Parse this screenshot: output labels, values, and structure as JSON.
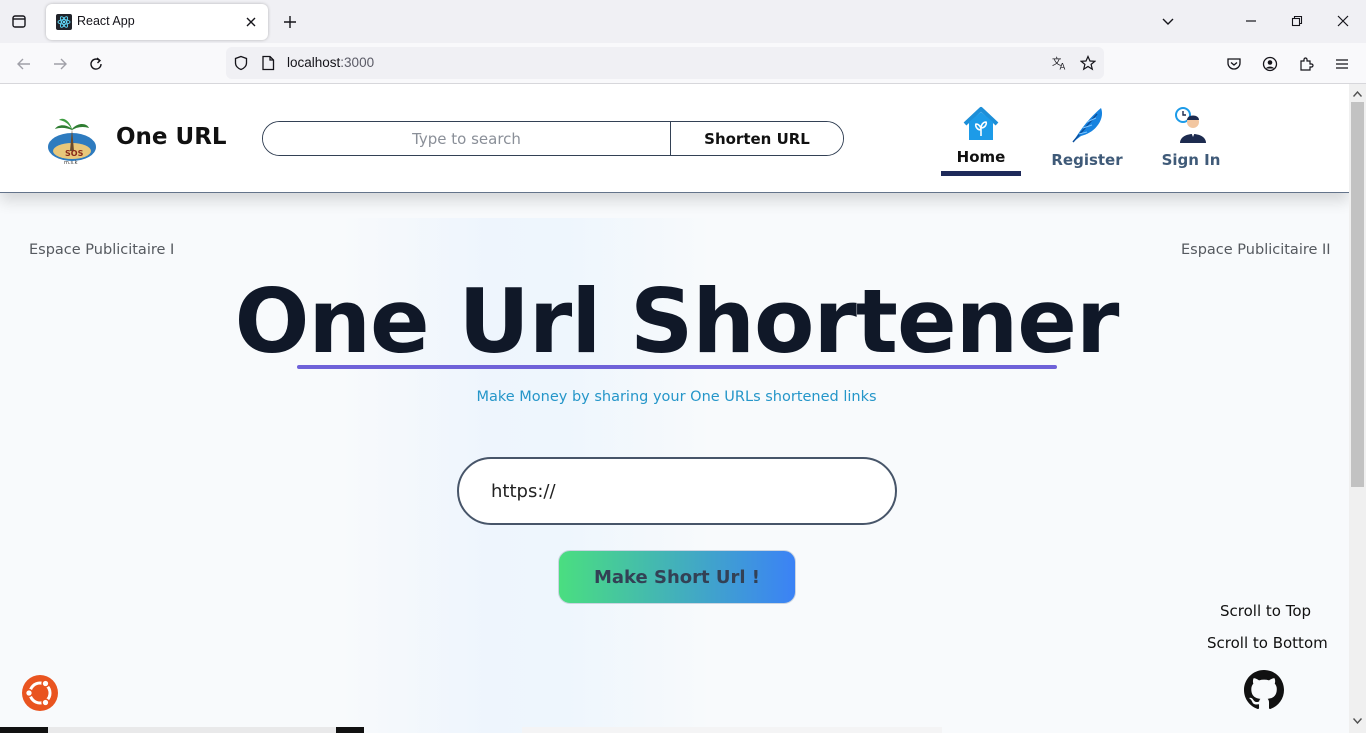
{
  "browser": {
    "tab_title": "React App",
    "url_host": "localhost",
    "url_port": ":3000"
  },
  "header": {
    "brand": "One URL",
    "search_placeholder": "Type to search",
    "search_button": "Shorten URL",
    "menu": [
      {
        "label": "Home",
        "active": true,
        "color": "#111111"
      },
      {
        "label": "Register",
        "active": false,
        "color": "#3f5a78"
      },
      {
        "label": "Sign In",
        "active": false,
        "color": "#3f5a78"
      }
    ]
  },
  "ads": {
    "left": "Espace Publicitaire I",
    "right": "Espace Publicitaire II"
  },
  "hero": {
    "title": "One Url Shortener",
    "subtitle": "Make Money by sharing your One URLs shortened links",
    "url_value": "https://",
    "button": "Make Short Url !"
  },
  "scroll": {
    "top": "Scroll to Top",
    "bottom": "Scroll to Bottom"
  },
  "colors": {
    "accent_underline": "#6f62d9",
    "subtitle": "#2596c9",
    "button_gradient_start": "#4ade80",
    "button_gradient_end": "#3b82f6"
  }
}
